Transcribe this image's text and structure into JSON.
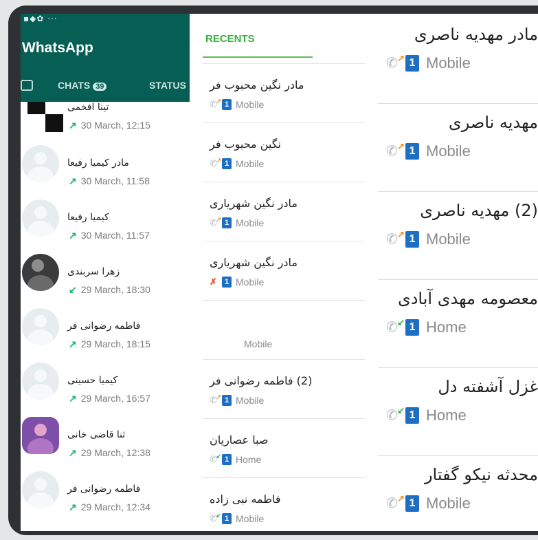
{
  "whatsapp": {
    "status_icons": "▪◆✿ ···",
    "title": "WhatsApp",
    "tabs": {
      "chats": "CHATS",
      "chats_badge": "39",
      "status": "STATUS"
    },
    "calls": [
      {
        "name": "تینا افخمی",
        "time": "30 March, 12:15",
        "dir": "out",
        "avatar": "qr"
      },
      {
        "name": "مادر کیمیا رفیعا",
        "time": "30 March, 11:58",
        "dir": "out",
        "avatar": "default"
      },
      {
        "name": "کیمیا رفیعا",
        "time": "30 March, 11:57",
        "dir": "out",
        "avatar": "default"
      },
      {
        "name": "زهرا سربندی",
        "time": "29 March, 18:30",
        "dir": "in",
        "avatar": "photo"
      },
      {
        "name": "فاطمه رضوانی فر",
        "time": "29 March, 18:15",
        "dir": "out",
        "avatar": "default"
      },
      {
        "name": "کیمیا حسینی",
        "time": "29 March, 16:57",
        "dir": "out",
        "avatar": "default"
      },
      {
        "name": "ثنا قاضی خانی",
        "time": "29 March, 12:38",
        "dir": "out",
        "avatar": "purple"
      },
      {
        "name": "فاطمه رضوانی فر",
        "time": "29 March, 12:34",
        "dir": "out",
        "avatar": "default"
      }
    ],
    "arrow_out": "↗",
    "arrow_in": "↙"
  },
  "recents": {
    "title": "RECENTS",
    "items": [
      {
        "name": "مادر نگین محبوب فر",
        "type": "Mobile",
        "call": "out",
        "sim": "1"
      },
      {
        "name": "نگین محبوب فر",
        "type": "Mobile",
        "call": "out",
        "sim": "1"
      },
      {
        "name": "مادر نگین شهریاری",
        "type": "Mobile",
        "call": "out",
        "sim": "1"
      },
      {
        "name": "مادر نگین شهریاری",
        "type": "Mobile",
        "call": "missed",
        "sim": "1"
      },
      {
        "name": "",
        "type": "Mobile",
        "call": "none",
        "sim": ""
      },
      {
        "name": "(2) فاطمه رضوانی فر",
        "type": "Mobile",
        "call": "out",
        "sim": "1"
      },
      {
        "name": "صبا عصاریان",
        "type": "Home",
        "call": "in",
        "sim": "1"
      },
      {
        "name": "فاطمه نبی زاده",
        "type": "Mobile",
        "call": "in",
        "sim": "1"
      }
    ]
  },
  "contacts": [
    {
      "name": "مادر مهدیه ناصری",
      "type": "Mobile",
      "call": "out",
      "sim": "1"
    },
    {
      "name": "مهدیه ناصری",
      "type": "Mobile",
      "call": "out",
      "sim": "1"
    },
    {
      "name": "(2) مهدیه ناصری",
      "type": "Mobile",
      "call": "out",
      "sim": "1"
    },
    {
      "name": "معصومه مهدی آبادی",
      "type": "Home",
      "call": "in",
      "sim": "1"
    },
    {
      "name": "غزل آشفته دل",
      "type": "Home",
      "call": "in",
      "sim": "1"
    },
    {
      "name": "محدثه نیکو گفتار",
      "type": "Mobile",
      "call": "out",
      "sim": "1"
    }
  ],
  "icons": {
    "phone": "✆",
    "missed": "✗",
    "arrow_out": "↗",
    "arrow_in": "↙"
  },
  "colors": {
    "whatsapp_green": "#075e54",
    "recents_accent": "#3dae3e",
    "sim_blue": "#1e6fc4",
    "outgoing": "#f29020",
    "incoming": "#2cb34a",
    "missed": "#e8542a"
  }
}
